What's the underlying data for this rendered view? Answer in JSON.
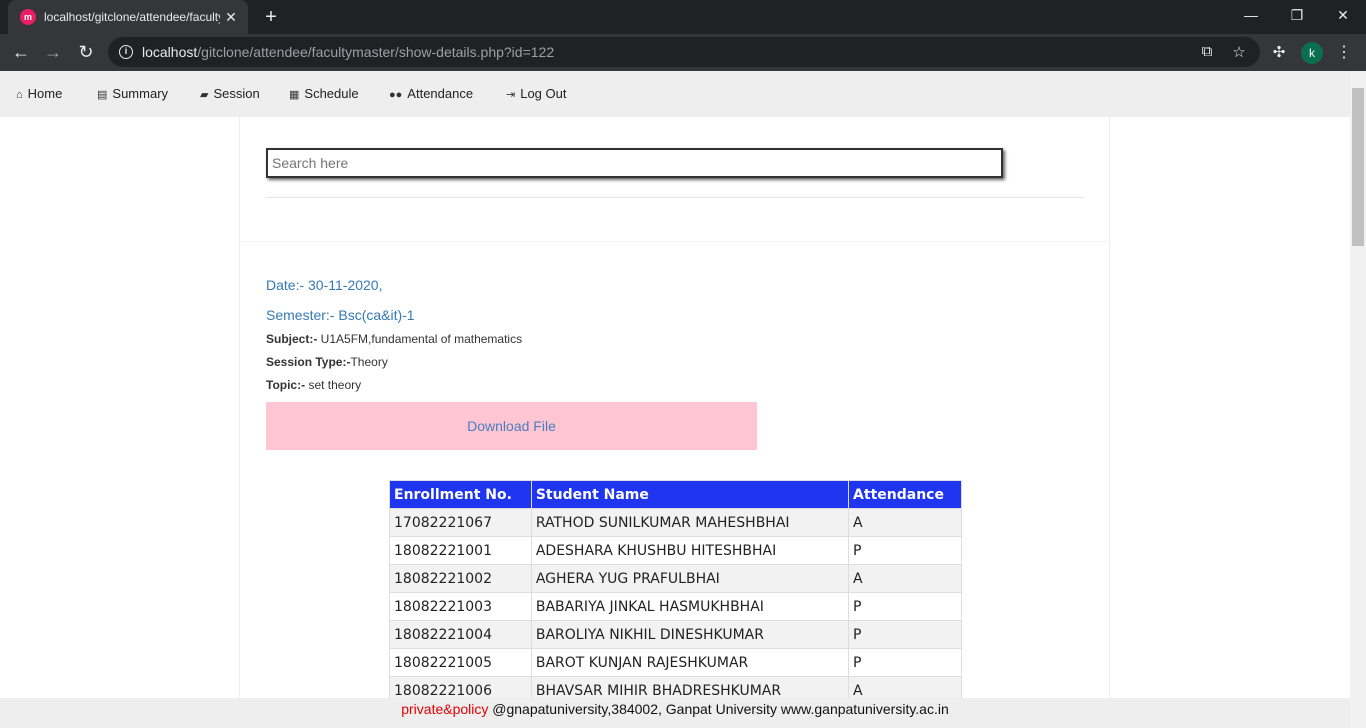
{
  "browser": {
    "tab_title": "localhost/gitclone/attendee/faculty",
    "tab_favicon_text": "m",
    "url_host": "localhost",
    "url_path": "/gitclone/attendee/facultymaster/show-details.php?id=122",
    "profile_initial": "k"
  },
  "nav": {
    "items": [
      {
        "icon": "home-icon",
        "label": "Home"
      },
      {
        "icon": "list-icon",
        "label": "Summary"
      },
      {
        "icon": "book-icon",
        "label": "Session"
      },
      {
        "icon": "calendar-icon",
        "label": "Schedule"
      },
      {
        "icon": "users-icon",
        "label": "Attendance"
      },
      {
        "icon": "logout-icon",
        "label": "Log Out"
      }
    ]
  },
  "search": {
    "placeholder": "Search here"
  },
  "details": {
    "date": "Date:- 30-11-2020,",
    "semester": "Semester:- Bsc(ca&it)-1",
    "subject_label": "Subject:-",
    "subject_value": " U1A5FM,fundamental of mathematics",
    "session_type_label": "Session Type:-",
    "session_type_value": "Theory",
    "topic_label": "Topic:-",
    "topic_value": " set theory",
    "download_label": "Download File"
  },
  "table": {
    "headers": [
      "Enrollment No.",
      "Student Name",
      "Attendance"
    ],
    "rows": [
      [
        "17082221067",
        "RATHOD SUNILKUMAR MAHESHBHAI",
        "A"
      ],
      [
        "18082221001",
        "ADESHARA KHUSHBU HITESHBHAI",
        "P"
      ],
      [
        "18082221002",
        "AGHERA YUG PRAFULBHAI",
        "A"
      ],
      [
        "18082221003",
        "BABARIYA JINKAL HASMUKHBHAI",
        "P"
      ],
      [
        "18082221004",
        "BAROLIYA NIKHIL DINESHKUMAR",
        "P"
      ],
      [
        "18082221005",
        "BAROT KUNJAN RAJESHKUMAR",
        "P"
      ],
      [
        "18082221006",
        "BHAVSAR MIHIR BHADRESHKUMAR",
        "A"
      ]
    ]
  },
  "footer": {
    "policy": "private&policy",
    "text": " @gnapatuniversity,384002, Ganpat University www.ganpatuniversity.ac.in"
  },
  "colors": {
    "table_header": "#1f35f0",
    "download_bg": "#ffc5d2",
    "link_blue": "#337ab7",
    "policy_red": "#e00000"
  }
}
